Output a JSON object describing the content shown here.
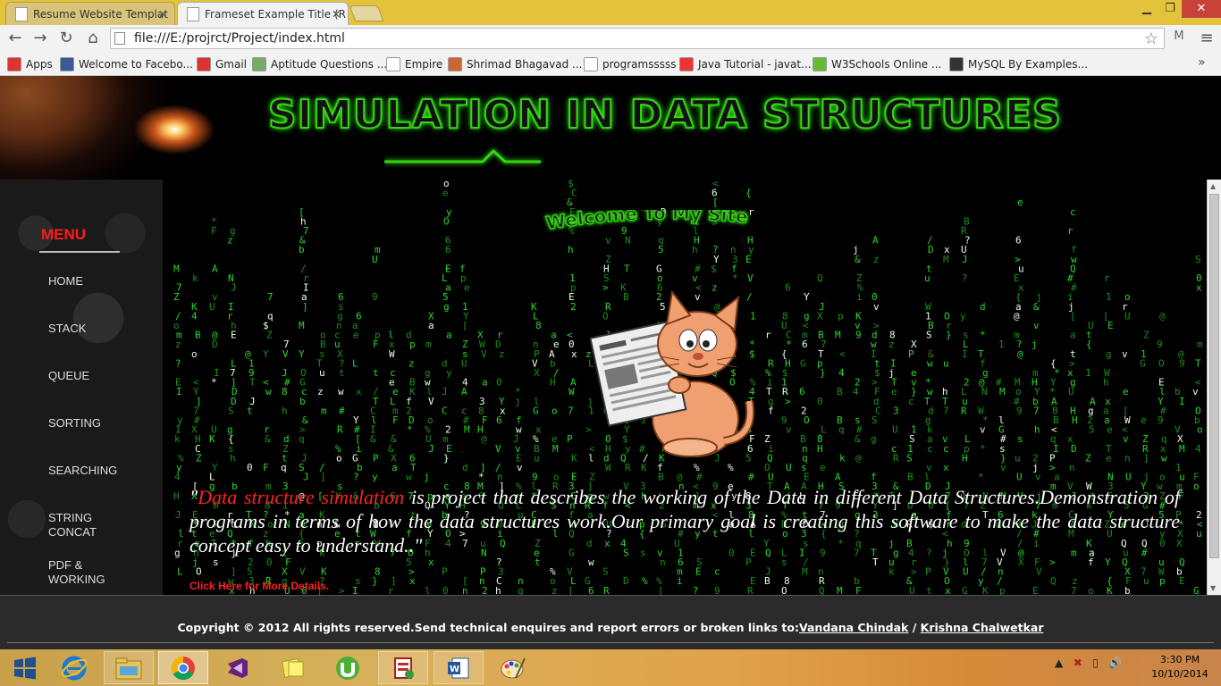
{
  "browser": {
    "tabs": [
      {
        "title": "Resume Website Templat"
      },
      {
        "title": "Frameset Example Title (R"
      }
    ],
    "window_controls": {
      "minimize": "▁",
      "maximize": "❐",
      "close": "✕"
    },
    "address": "file:///E:/projrct/Project/index.html",
    "bookmarks": [
      {
        "label": "Apps",
        "icon": "apps-grid-icon",
        "color": "#d33"
      },
      {
        "label": "Welcome to Facebo...",
        "icon": "facebook-icon",
        "color": "#3b5998"
      },
      {
        "label": "Gmail",
        "icon": "gmail-icon",
        "color": "#d33"
      },
      {
        "label": "Aptitude Questions ...",
        "icon": "aptitude-icon",
        "color": "#7a6"
      },
      {
        "label": "Empire",
        "icon": "page-icon",
        "color": "#fff"
      },
      {
        "label": "Shrimad Bhagavad ...",
        "icon": "gita-icon",
        "color": "#c63"
      },
      {
        "label": "programsssss",
        "icon": "page-icon",
        "color": "#fff"
      },
      {
        "label": "Java Tutorial - javat...",
        "icon": "java-icon",
        "color": "#e33"
      },
      {
        "label": "W3Schools Online ...",
        "icon": "w3schools-icon",
        "color": "#6b3"
      },
      {
        "label": "MySQL By Examples...",
        "icon": "mysql-icon",
        "color": "#333"
      }
    ]
  },
  "site": {
    "title": "SIMULATION IN DATA STRUCTURES",
    "menu_title": "MENU",
    "nav": [
      {
        "label": "HOME"
      },
      {
        "label": "STACK"
      },
      {
        "label": "QUEUE"
      },
      {
        "label": "SORTING"
      },
      {
        "label": "SEARCHING"
      },
      {
        "label": "STRING CONCAT"
      },
      {
        "label": "PDF & WORKING"
      }
    ],
    "welcome": "Welcome To My Site",
    "intro_open_quote": "\"",
    "intro_highlight": "Data structure simulation",
    "intro_rest": " is project that describes the working of the Data in different Data Structures.Demonstration of programs in terms of how the data structures work.Our primary goal is creating this software to make the data structure concept easy to understand..\"",
    "more_link": "Click Here for More Details.",
    "footer_text": "Copyright © 2012 All rights reserved.Send technical enquires and report errors or broken links to:",
    "footer_link1": "Vandana Chindak",
    "footer_sep": " / ",
    "footer_link2": " Krishna Chalwetkar"
  },
  "colors": {
    "accent_green": "#39d11a",
    "menu_red": "#ff1a1a",
    "matrix_green": "#2bd62b"
  },
  "taskbar": {
    "apps": [
      {
        "icon": "windows-start-icon"
      },
      {
        "icon": "internet-explorer-icon"
      },
      {
        "icon": "file-explorer-icon"
      },
      {
        "icon": "chrome-icon"
      },
      {
        "icon": "visual-studio-icon"
      },
      {
        "icon": "sticky-notes-icon"
      },
      {
        "icon": "utorrent-icon"
      },
      {
        "icon": "installer-icon"
      },
      {
        "icon": "word-icon"
      },
      {
        "icon": "paint-icon"
      }
    ],
    "time": "3:30 PM",
    "date": "10/10/2014"
  }
}
